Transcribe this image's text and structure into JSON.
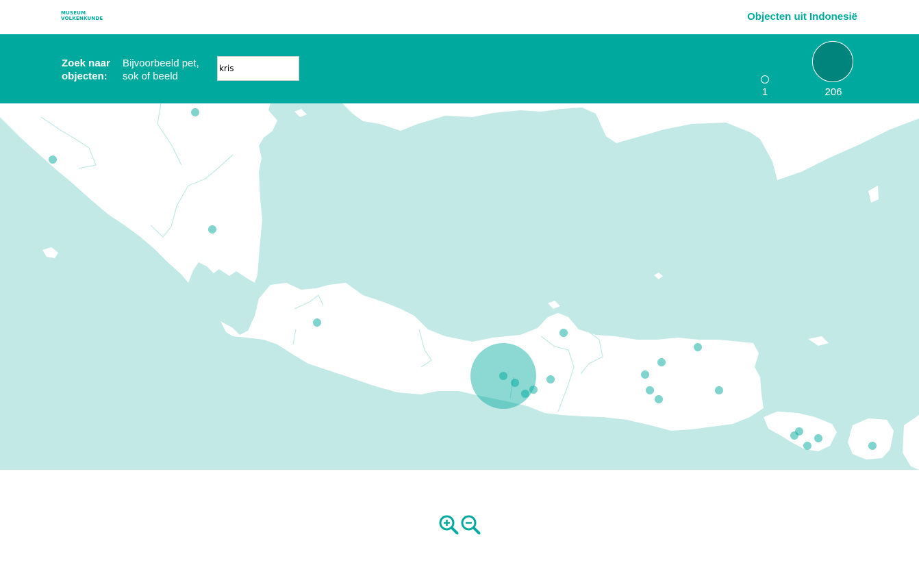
{
  "header": {
    "logo_line1": "MUSEUM",
    "logo_line2": "VOLKENKUNDE",
    "title": "Objecten uit Indonesië"
  },
  "search": {
    "label": "Zoek naar objecten:",
    "hint": "Bijvoorbeeld pet, sok of beeld",
    "value": "kris"
  },
  "legend": {
    "min_label": "1",
    "max_label": "206"
  },
  "map": {
    "sea_color": "#c2e9e6",
    "land_color": "#ffffff",
    "marker_color": "#00a99d",
    "markers_shown": 26,
    "largest_marker_count": 206
  },
  "controls": {
    "zoom_in_icon": "zoom-in-magnifier-icon",
    "zoom_out_icon": "zoom-out-magnifier-icon"
  },
  "colors": {
    "brand": "#00a99d",
    "brand_dark": "#00847b"
  }
}
